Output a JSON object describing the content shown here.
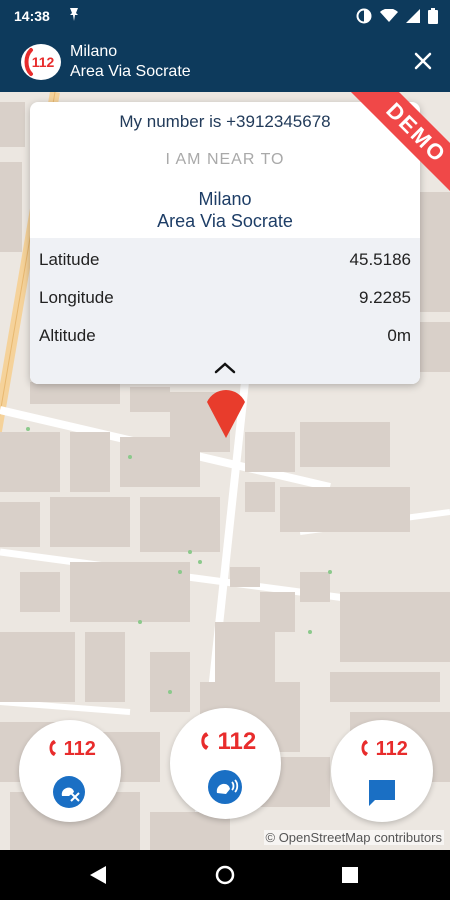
{
  "status_bar": {
    "time": "14:38"
  },
  "header": {
    "city": "Milano",
    "area": "Area Via Socrate",
    "logo_text": "112"
  },
  "card": {
    "my_number": "My number is +3912345678",
    "near_label": "I AM NEAR TO",
    "city": "Milano",
    "area": "Area Via Socrate",
    "rows": [
      {
        "label": "Latitude",
        "value": "45.5186"
      },
      {
        "label": "Longitude",
        "value": "9.2285"
      },
      {
        "label": "Altitude",
        "value": "0m"
      }
    ]
  },
  "demo_label": "DEMO",
  "actions": [
    {
      "label": "112",
      "icon": "deaf-icon"
    },
    {
      "label": "112",
      "icon": "speaking-head-icon"
    },
    {
      "label": "112",
      "icon": "chat-icon"
    }
  ],
  "attribution": "© OpenStreetMap contributors",
  "colors": {
    "header": "#0d3a5c",
    "accent": "#e82c2c",
    "demo": "#f04848",
    "blue": "#1a6fc4"
  }
}
